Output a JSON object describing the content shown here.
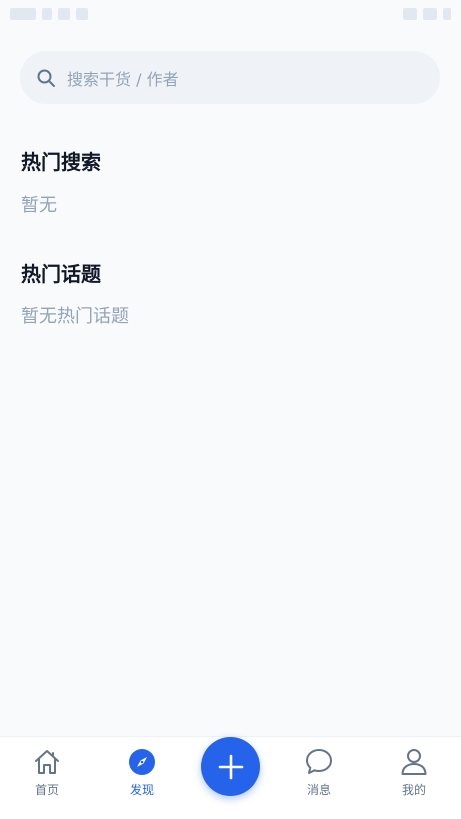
{
  "search": {
    "placeholder": "搜索干货 / 作者",
    "icon": "search-icon"
  },
  "sections": {
    "hot_search": {
      "title": "热门搜索",
      "empty_text": "暂无"
    },
    "hot_topics": {
      "title": "热门话题",
      "empty_text": "暂无热门话题"
    }
  },
  "bottom_nav": {
    "items": [
      {
        "label": "首页",
        "icon": "home-icon",
        "active": false
      },
      {
        "label": "发现",
        "icon": "compass-icon",
        "active": true
      },
      {
        "label": "消息",
        "icon": "chat-bubble-icon",
        "active": false
      },
      {
        "label": "我的",
        "icon": "user-icon",
        "active": false
      }
    ],
    "fab_icon": "plus-icon"
  },
  "colors": {
    "accent": "#2563eb",
    "background": "#f8fafc",
    "muted_text": "#94a3b8",
    "nav_text": "#64748b"
  }
}
